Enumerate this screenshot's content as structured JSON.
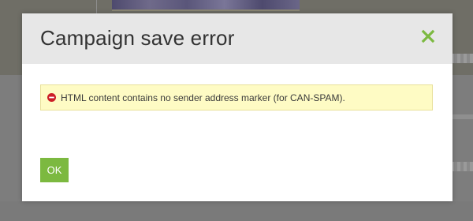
{
  "dialog": {
    "title": "Campaign save error",
    "error_message": "HTML content contains no sender address marker (for CAN-SPAM).",
    "ok_label": "OK",
    "close_icon": "close-icon",
    "error_icon": "error-circle-icon"
  },
  "colors": {
    "accent_green": "#7cb940",
    "error_background": "#fefbc4",
    "error_icon_red": "#cc1f27",
    "header_background": "#e7e7e7"
  }
}
